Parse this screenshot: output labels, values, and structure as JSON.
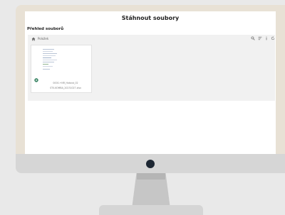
{
  "page": {
    "title": "Stáhnout soubory",
    "section_title": "Přehled souborů"
  },
  "toolbar": {
    "breadcrumb": "Položek",
    "icons": [
      "home-icon",
      "search-icon",
      "sort-icon",
      "info-icon",
      "refresh-icon"
    ]
  },
  "files": [
    {
      "name_line1": "0000-+NR_Hotová_02",
      "name_line2": "ST0-KOMBA_20231027.xlsx",
      "icon": "spreadsheet-icon"
    }
  ],
  "colors": {
    "frame": "#e8e1d5",
    "chin": "#d6d6d6",
    "panel": "#f1f1f1",
    "file_icon": "#2e7d5b"
  }
}
